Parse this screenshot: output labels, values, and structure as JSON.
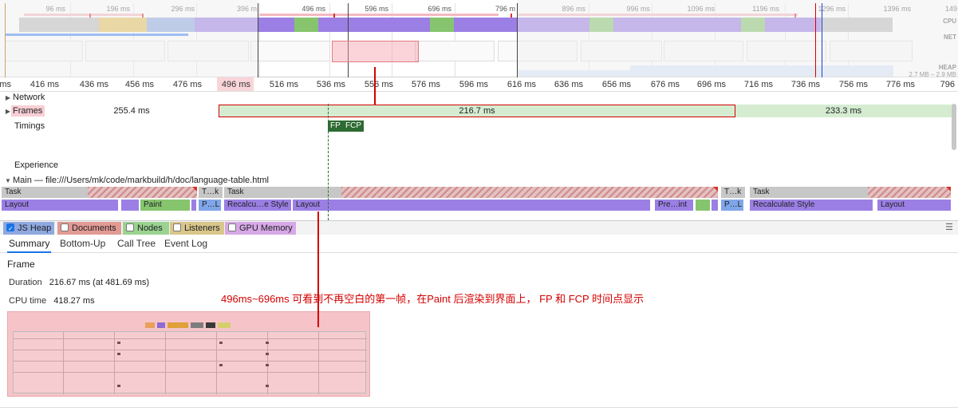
{
  "overview": {
    "ticks": [
      "96 ms",
      "196 ms",
      "296 ms",
      "396 m",
      "496 ms",
      "596 ms",
      "696 ms",
      "796 m",
      "896 ms",
      "996 ms",
      "1096 ms",
      "1196 ms",
      "1296 ms",
      "1396 ms",
      "149"
    ],
    "cpu_label": "CPU",
    "net_label": "NET",
    "heap_label": "HEAP",
    "heap_range": "2.7 MB – 2.9 MB"
  },
  "ruler": {
    "ticks": [
      "ms",
      "416 ms",
      "436 ms",
      "456 ms",
      "476 ms",
      "496 ms",
      "516 ms",
      "536 ms",
      "556 ms",
      "576 ms",
      "596 ms",
      "616 ms",
      "636 ms",
      "656 ms",
      "676 ms",
      "696 ms",
      "716 ms",
      "736 ms",
      "756 ms",
      "776 ms",
      "796"
    ]
  },
  "tracks": {
    "network": "Network",
    "frames": "Frames",
    "timings": "Timings",
    "experience": "Experience",
    "main": "Main — file:///Users/mk/code/markbuild/h/doc/language-table.html"
  },
  "frames": {
    "f1": "255.4 ms",
    "f2": "216.7 ms",
    "f3": "233.3 ms"
  },
  "timings": {
    "fp": "FP",
    "fcp": "FCP"
  },
  "flame": {
    "task": "Task",
    "tk": "T…k",
    "layout": "Layout",
    "paint": "Paint",
    "pl": "P…L",
    "recalc_short": "Recalcu…e Style",
    "preint": "Pre…int",
    "recalc": "Recalculate Style"
  },
  "checks": {
    "js_heap": "JS Heap",
    "documents": "Documents",
    "nodes": "Nodes",
    "listeners": "Listeners",
    "gpu": "GPU Memory"
  },
  "tabs": [
    "Summary",
    "Bottom-Up",
    "Call Tree",
    "Event Log"
  ],
  "summary": {
    "title": "Frame",
    "duration_key": "Duration",
    "duration_val": "216.67 ms (at 481.69 ms)",
    "cpu_key": "CPU time",
    "cpu_val": "418.27 ms"
  },
  "annotation": {
    "text": "496ms~696ms 可看到不再空白的第一帧，在Paint 后渲染到界面上， FP 和 FCP 时间点显示"
  },
  "colors": {
    "accent": "#1a73e8",
    "annotation": "#d40000",
    "frame_green": "#d5ecd1",
    "timing_green": "#2e6b32"
  }
}
